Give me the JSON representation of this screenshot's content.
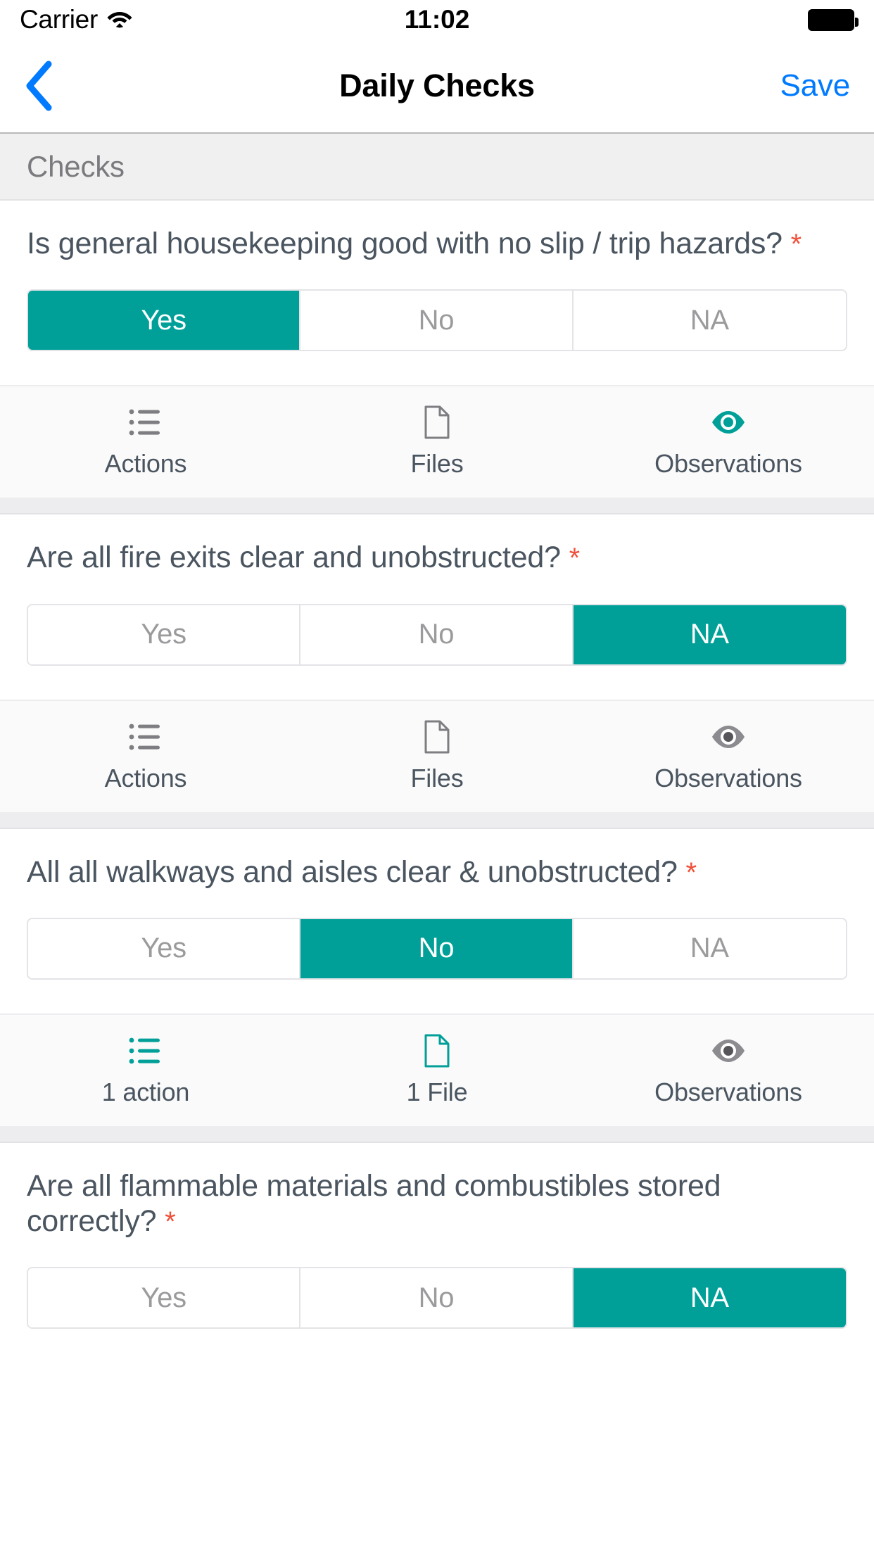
{
  "status_bar": {
    "carrier": "Carrier",
    "wifi_icon": "wifi-icon",
    "time": "11:02",
    "battery_icon": "battery-full-icon"
  },
  "nav_bar": {
    "back_icon": "chevron-left-icon",
    "title": "Daily Checks",
    "save_label": "Save"
  },
  "section": {
    "header_label": "Checks"
  },
  "colors": {
    "accent_teal": "#00a099",
    "link_blue": "#007aff",
    "required_red": "#f0503a",
    "text_slate": "#4a5560",
    "muted_gray": "#9b9b9e"
  },
  "segment_options": [
    "Yes",
    "No",
    "NA"
  ],
  "questions": [
    {
      "text": "Is general housekeeping good with no slip / trip hazards?",
      "required_marker": "*",
      "options": [
        "Yes",
        "No",
        "NA"
      ],
      "selected": "Yes",
      "actions": [
        {
          "icon": "list-icon",
          "label": "Actions",
          "active": false
        },
        {
          "icon": "file-icon",
          "label": "Files",
          "active": false
        },
        {
          "icon": "eye-icon",
          "label": "Observations",
          "active": true
        }
      ]
    },
    {
      "text": "Are all fire exits clear and unobstructed?",
      "required_marker": "*",
      "options": [
        "Yes",
        "No",
        "NA"
      ],
      "selected": "NA",
      "actions": [
        {
          "icon": "list-icon",
          "label": "Actions",
          "active": false
        },
        {
          "icon": "file-icon",
          "label": "Files",
          "active": false
        },
        {
          "icon": "eye-icon",
          "label": "Observations",
          "active": false
        }
      ]
    },
    {
      "text": "All all walkways and aisles clear & unobstructed?",
      "required_marker": "*",
      "options": [
        "Yes",
        "No",
        "NA"
      ],
      "selected": "No",
      "actions": [
        {
          "icon": "list-icon",
          "label": "1 action",
          "active": true
        },
        {
          "icon": "file-icon",
          "label": "1 File",
          "active": true
        },
        {
          "icon": "eye-icon",
          "label": "Observations",
          "active": false
        }
      ]
    },
    {
      "text": "Are all flammable materials and combustibles stored correctly?",
      "required_marker": "*",
      "options": [
        "Yes",
        "No",
        "NA"
      ],
      "selected": "NA",
      "actions": []
    }
  ]
}
